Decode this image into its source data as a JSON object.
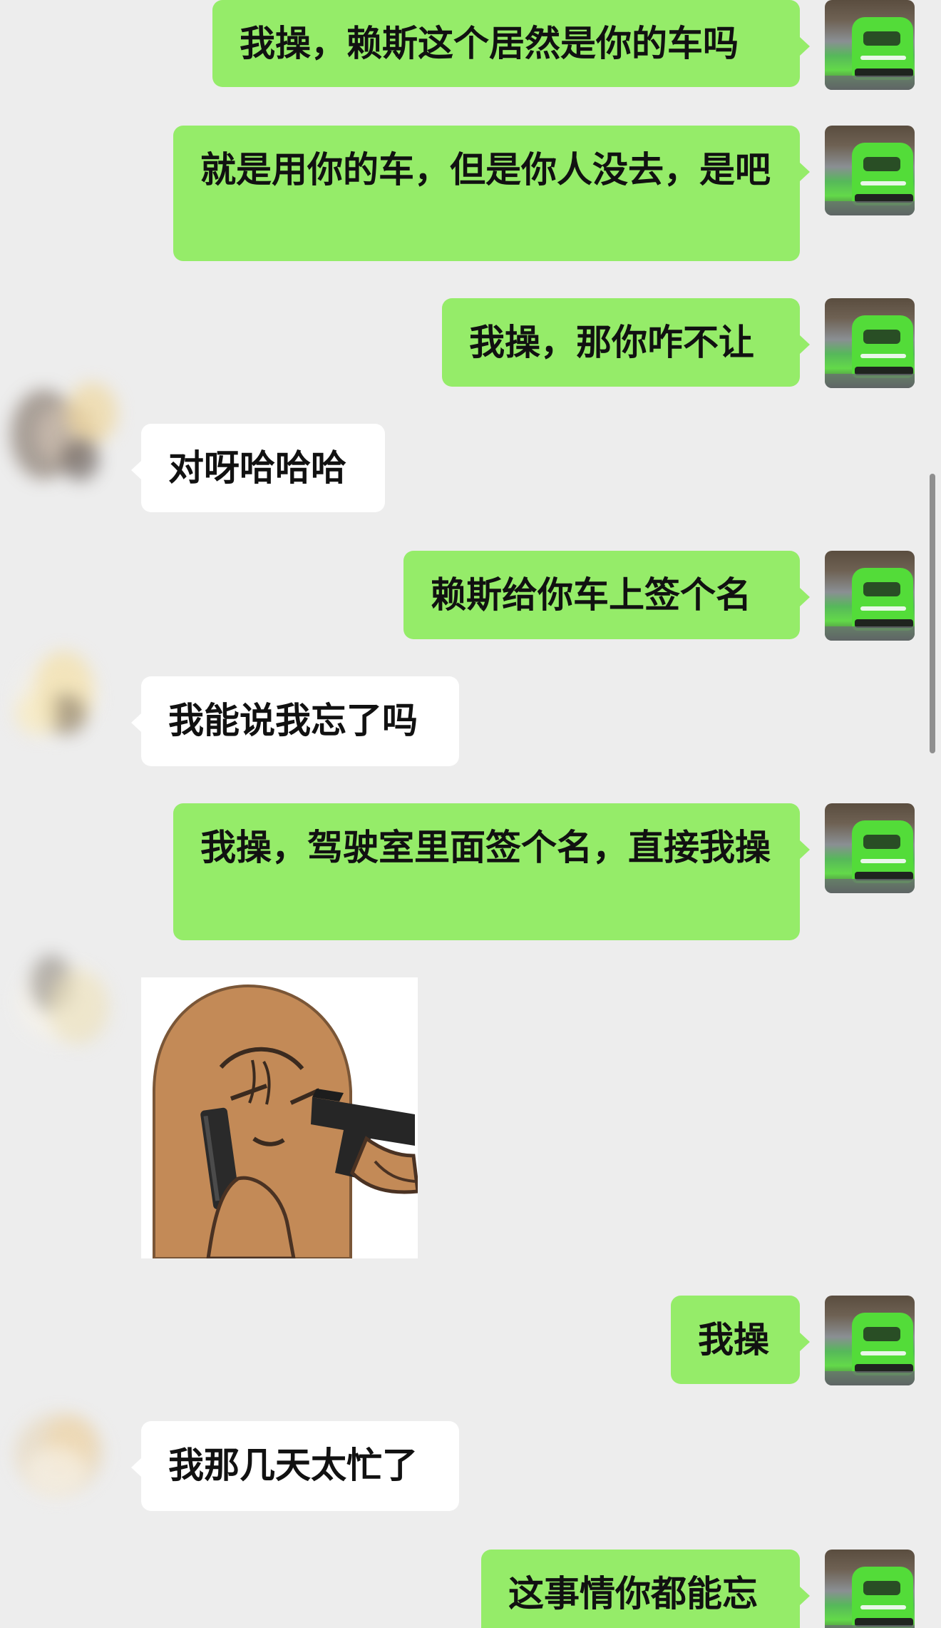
{
  "messages": [
    {
      "id": "m1",
      "sender": "me",
      "text": "我操，赖斯这个居然是你的车吗"
    },
    {
      "id": "m2",
      "sender": "me",
      "text": "就是用你的车，但是你人没去，是吧"
    },
    {
      "id": "m3",
      "sender": "me",
      "text": "我操，那你咋不让"
    },
    {
      "id": "m4",
      "sender": "them",
      "text": "对呀哈哈哈"
    },
    {
      "id": "m5",
      "sender": "me",
      "text": "赖斯给你车上签个名"
    },
    {
      "id": "m6",
      "sender": "them",
      "text": "我能说我忘了吗"
    },
    {
      "id": "m7",
      "sender": "me",
      "text": "我操，驾驶室里面签个名，直接我操"
    },
    {
      "id": "m8",
      "sender": "them",
      "type": "sticker",
      "sticker": "crying-face-with-gun-sticker"
    },
    {
      "id": "m9",
      "sender": "me",
      "text": "我操"
    },
    {
      "id": "m10",
      "sender": "them",
      "text": "我那几天太忙了"
    },
    {
      "id": "m11",
      "sender": "me",
      "text": "这事情你都能忘"
    }
  ],
  "colors": {
    "background": "#ededed",
    "my_bubble": "#95ec69",
    "their_bubble": "#ffffff"
  }
}
